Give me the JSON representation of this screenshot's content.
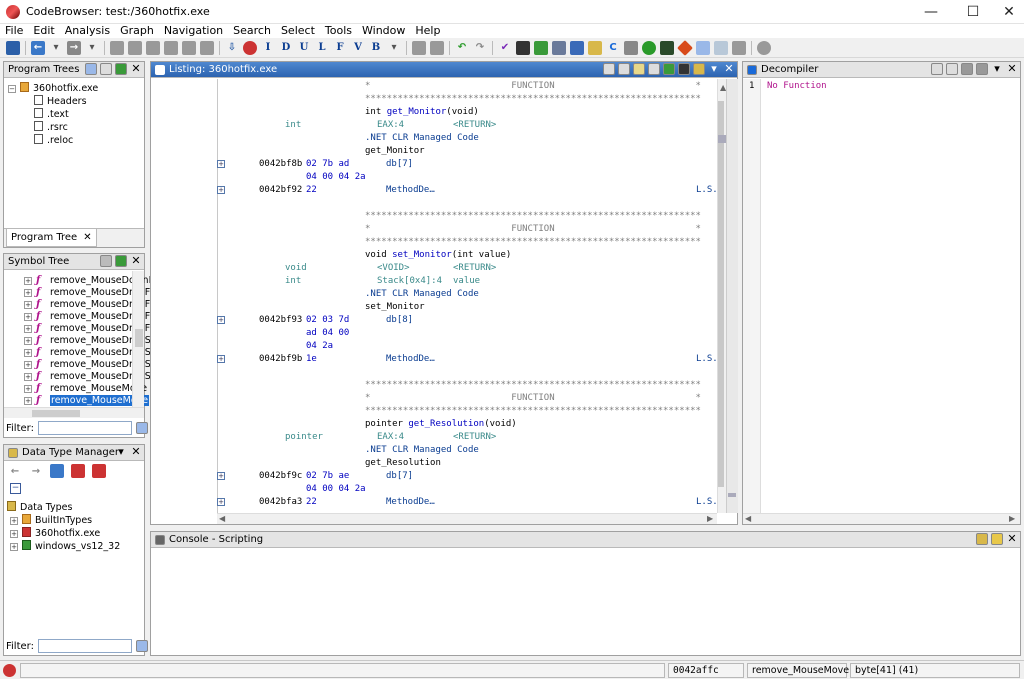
{
  "window": {
    "title": "CodeBrowser: test:/360hotfix.exe",
    "minimize": "—",
    "maximize": "☐",
    "close": "✕"
  },
  "menu": [
    "File",
    "Edit",
    "Analysis",
    "Graph",
    "Navigation",
    "Search",
    "Select",
    "Tools",
    "Window",
    "Help"
  ],
  "toolbar_letters": [
    "I",
    "D",
    "U",
    "L",
    "F",
    "V",
    "B"
  ],
  "program_trees": {
    "title": "Program Trees",
    "root": "360hotfix.exe",
    "children": [
      "Headers",
      ".text",
      ".rsrc",
      ".reloc"
    ],
    "tab": "Program Tree",
    "tab_close": "✕"
  },
  "symbol_tree": {
    "title": "Symbol Tree",
    "items": [
      "remove_MouseDownE",
      "remove_MouseDragF",
      "remove_MouseDragF",
      "remove_MouseDragF",
      "remove_MouseDragF",
      "remove_MouseDragS",
      "remove_MouseDragS",
      "remove_MouseDragS",
      "remove_MouseDragS",
      "remove_MouseMove",
      "remove_MouseMove"
    ],
    "filter_label": "Filter:"
  },
  "data_type_manager": {
    "title": "Data Type Manager",
    "root": "Data Types",
    "items": [
      "BuiltInTypes",
      "360hotfix.exe",
      "windows_vs12_32"
    ],
    "filter_label": "Filter:"
  },
  "listing": {
    "title": "Listing:  360hotfix.exe",
    "lines": [
      {
        "col": "stars",
        "text": "*                          FUNCTION                          *",
        "cls": "c-gray"
      },
      {
        "col": "stars",
        "text": "**************************************************************",
        "cls": "c-gray"
      },
      {
        "col": "sig",
        "pre": "int ",
        "name": "get_Monitor",
        "post": "(void)"
      },
      {
        "col": "var",
        "type": "int",
        "storage": "EAX:4",
        "label": "<RETURN>"
      },
      {
        "col": "mono",
        "text": ".NET CLR Managed Code",
        "cls": "c-navy"
      },
      {
        "col": "mono",
        "text": "get_Monitor",
        "cls": "c-black"
      },
      {
        "col": "code",
        "expander": true,
        "addr": "0042bf8b",
        "bytes": "02 7b ad",
        "mnem": "db[7]"
      },
      {
        "col": "code",
        "addr": "",
        "bytes": "04 00 04 2a",
        "mnem": ""
      },
      {
        "col": "code",
        "expander": true,
        "addr": "0042bf92",
        "bytes": "22",
        "mnem": "MethodDe…",
        "ref": "L.S."
      },
      {
        "col": "blank"
      },
      {
        "col": "stars",
        "text": "**************************************************************",
        "cls": "c-gray"
      },
      {
        "col": "stars",
        "text": "*                          FUNCTION                          *",
        "cls": "c-gray"
      },
      {
        "col": "stars",
        "text": "**************************************************************",
        "cls": "c-gray"
      },
      {
        "col": "sig",
        "pre": "void ",
        "name": "set_Monitor",
        "post": "(int value)"
      },
      {
        "col": "var",
        "type": "void",
        "storage": "<VOID>",
        "label": "<RETURN>"
      },
      {
        "col": "var",
        "type": "int",
        "storage": "Stack[0x4]:4",
        "label": "value"
      },
      {
        "col": "mono",
        "text": ".NET CLR Managed Code",
        "cls": "c-navy"
      },
      {
        "col": "mono",
        "text": "set_Monitor",
        "cls": "c-black"
      },
      {
        "col": "code",
        "expander": true,
        "addr": "0042bf93",
        "bytes": "02 03 7d",
        "mnem": "db[8]"
      },
      {
        "col": "code",
        "addr": "",
        "bytes": "ad 04 00",
        "mnem": ""
      },
      {
        "col": "code",
        "addr": "",
        "bytes": "04 2a",
        "mnem": ""
      },
      {
        "col": "code",
        "expander": true,
        "addr": "0042bf9b",
        "bytes": "1e",
        "mnem": "MethodDe…",
        "ref": "L.S."
      },
      {
        "col": "blank"
      },
      {
        "col": "stars",
        "text": "**************************************************************",
        "cls": "c-gray"
      },
      {
        "col": "stars",
        "text": "*                          FUNCTION                          *",
        "cls": "c-gray"
      },
      {
        "col": "stars",
        "text": "**************************************************************",
        "cls": "c-gray"
      },
      {
        "col": "sig",
        "pre": "pointer ",
        "name": "get_Resolution",
        "post": "(void)"
      },
      {
        "col": "var",
        "type": "pointer",
        "storage": "EAX:4",
        "label": "<RETURN>"
      },
      {
        "col": "mono",
        "text": ".NET CLR Managed Code",
        "cls": "c-navy"
      },
      {
        "col": "mono",
        "text": "get_Resolution",
        "cls": "c-black"
      },
      {
        "col": "code",
        "expander": true,
        "addr": "0042bf9c",
        "bytes": "02 7b ae",
        "mnem": "db[7]"
      },
      {
        "col": "code",
        "addr": "",
        "bytes": "04 00 04 2a",
        "mnem": ""
      },
      {
        "col": "code",
        "expander": true,
        "addr": "0042bfa3",
        "bytes": "22",
        "mnem": "MethodDe…",
        "ref": "L.S."
      }
    ]
  },
  "decompiler": {
    "title": "Decompiler",
    "line_no": "1",
    "text": "No Function"
  },
  "console": {
    "title": "Console - Scripting"
  },
  "status": {
    "address": "0042affc",
    "function": "remove_MouseMove",
    "value": "byte[41]  (41)"
  }
}
